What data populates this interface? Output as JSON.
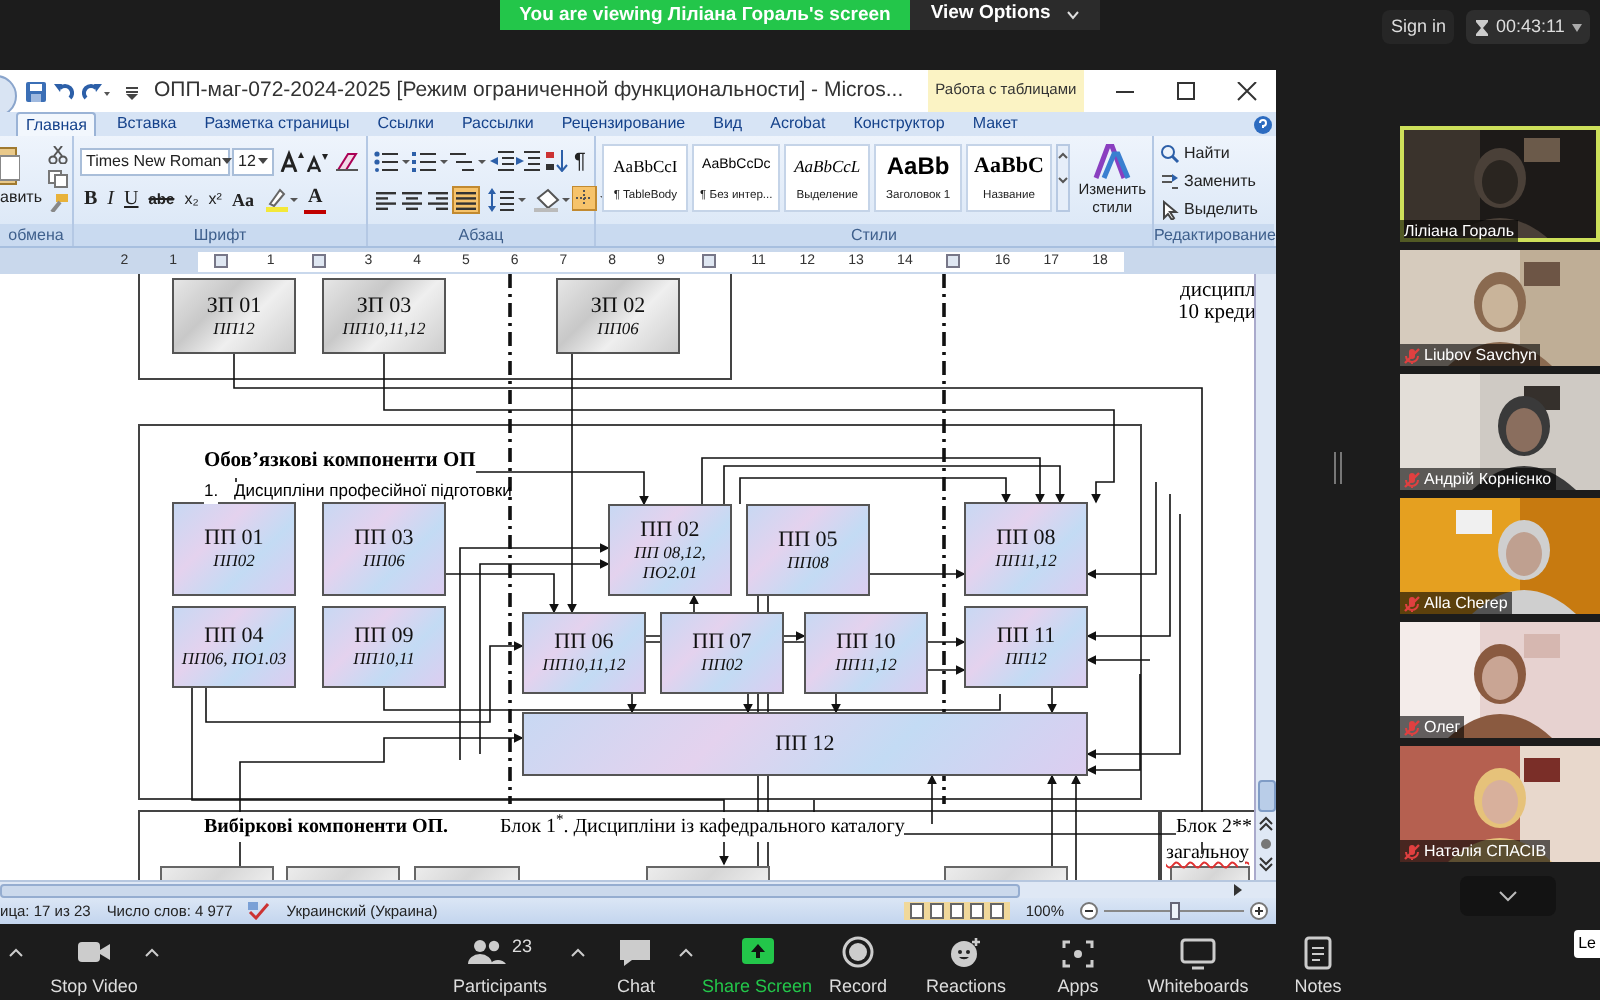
{
  "banner": {
    "text": "You are viewing Ліліана Гораль's screen",
    "view_options": "View Options"
  },
  "top_right": {
    "sign_in": "Sign in",
    "timer": "00:43:11"
  },
  "word": {
    "title": "ОПП-маг-072-2024-2025 [Режим ограниченной функциональности] - Micros...",
    "context_tab": "Работа с таблицами",
    "tabs": [
      {
        "label": "Главная",
        "selected": true
      },
      {
        "label": "Вставка",
        "selected": false
      },
      {
        "label": "Разметка страницы",
        "selected": false
      },
      {
        "label": "Ссылки",
        "selected": false
      },
      {
        "label": "Рассылки",
        "selected": false
      },
      {
        "label": "Рецензирование",
        "selected": false
      },
      {
        "label": "Вид",
        "selected": false
      },
      {
        "label": "Acrobat",
        "selected": false
      },
      {
        "label": "Конструктор",
        "selected": false
      },
      {
        "label": "Макет",
        "selected": false
      }
    ],
    "clipboard": {
      "paste_label": "авить",
      "group_label": "обмена"
    },
    "font": {
      "name": "Times New Roman",
      "size": "12",
      "format_buttons": [
        "B",
        "I",
        "U",
        "abe",
        "x₂",
        "x²",
        "Aa"
      ],
      "color_button": "A",
      "group_label": "Шрифт"
    },
    "paragraph": {
      "show_marks": "¶",
      "align_buttons": [
        {
          "selected": false
        },
        {
          "selected": false
        },
        {
          "selected": false
        },
        {
          "selected": true
        }
      ],
      "group_label": "Абзац"
    },
    "styles": {
      "items": [
        {
          "kind": "serif",
          "sample": "AaBbCcI",
          "name": "¶ TableBody"
        },
        {
          "kind": "sans",
          "sample": "AaBbCcDc",
          "name": "¶ Без интер..."
        },
        {
          "kind": "italic",
          "sample": "AaBbCcL",
          "name": "Выделение"
        },
        {
          "kind": "heading",
          "sample": "AaBb",
          "name": "Заголовок 1"
        },
        {
          "kind": "title",
          "sample": "AaBbC",
          "name": "Название"
        }
      ],
      "change_label": "Изменить стили",
      "group_label": "Стили"
    },
    "editing": {
      "items": [
        "Найти",
        "Заменить",
        "Выделить"
      ],
      "group_label": "Редактирование"
    },
    "ruler": [
      {
        "kind": "number",
        "text": "2"
      },
      {
        "kind": "number",
        "text": "1"
      },
      {
        "kind": "mark"
      },
      {
        "kind": "number",
        "text": "1"
      },
      {
        "kind": "mark"
      },
      {
        "kind": "number",
        "text": "3"
      },
      {
        "kind": "number",
        "text": "4"
      },
      {
        "kind": "number",
        "text": "5"
      },
      {
        "kind": "number",
        "text": "6"
      },
      {
        "kind": "number",
        "text": "7"
      },
      {
        "kind": "number",
        "text": "8"
      },
      {
        "kind": "number",
        "text": "9"
      },
      {
        "kind": "mark"
      },
      {
        "kind": "number",
        "text": "11"
      },
      {
        "kind": "number",
        "text": "12"
      },
      {
        "kind": "number",
        "text": "13"
      },
      {
        "kind": "number",
        "text": "14"
      },
      {
        "kind": "mark"
      },
      {
        "kind": "number",
        "text": "16"
      },
      {
        "kind": "number",
        "text": "17"
      },
      {
        "kind": "number",
        "text": "18"
      }
    ],
    "document": {
      "side_note": [
        "дисципл",
        "10 креди"
      ],
      "required_heading": "Обов’язкові компоненти ОП",
      "required_item": {
        "number": "1.",
        "text": "Дисципліни професійної підготовки"
      },
      "nodes": [
        {
          "kind": "zp",
          "title": "ЗП 01",
          "note": "ПП12"
        },
        {
          "kind": "zp",
          "title": "ЗП 03",
          "note": "ПП10,11,12"
        },
        {
          "kind": "zp",
          "title": "ЗП 02",
          "note": "ПП06"
        },
        {
          "kind": "pp",
          "title": "ПП 01",
          "note": "ПП02"
        },
        {
          "kind": "pp",
          "title": "ПП 03",
          "note": "ПП06"
        },
        {
          "kind": "pp",
          "title": "ПП 02",
          "note": "ПП 08,12, ПО2.01"
        },
        {
          "kind": "pp",
          "title": "ПП 05",
          "note": "ПП08"
        },
        {
          "kind": "pp",
          "title": "ПП 08",
          "note": "ПП11,12"
        },
        {
          "kind": "pp",
          "title": "ПП 04",
          "note": "ПП06, ПО1.03"
        },
        {
          "kind": "pp",
          "title": "ПП 09",
          "note": "ПП10,11"
        },
        {
          "kind": "pp",
          "title": "ПП 06",
          "note": "ПП10,11,12"
        },
        {
          "kind": "pp",
          "title": "ПП 07",
          "note": "ПП02"
        },
        {
          "kind": "pp",
          "title": "ПП 10",
          "note": "ПП11,12"
        },
        {
          "kind": "pp",
          "title": "ПП 11",
          "note": "ПП12"
        },
        {
          "kind": "pp",
          "title": "ПП 12"
        }
      ],
      "elective_heading": "Вибіркові компоненти ОП.",
      "block_1": "Блок 1$^{*}$. Дисципліни із кафедрального каталогу",
      "block_2": "Блок 2**",
      "block_2_note": "загальноу"
    },
    "status_bar": {
      "page": "ица: 17 из 23",
      "words": "Число слов: 4 977",
      "language": "Украинский (Украина)",
      "zoom": "100%",
      "zoom_slider": {
        "level": 0.5
      }
    }
  },
  "participants": [
    {
      "name": "Ліліана Гораль",
      "muted": false,
      "speaking": true
    },
    {
      "name": "Liubov Savchyn",
      "muted": true,
      "speaking": false
    },
    {
      "name": "Андрій Корнієнко",
      "muted": true,
      "speaking": false
    },
    {
      "name": "Alla Cherep",
      "muted": true,
      "speaking": false
    },
    {
      "name": "Олег",
      "muted": true,
      "speaking": false
    },
    {
      "name": "Наталія СПАСІВ",
      "muted": true,
      "speaking": false
    }
  ],
  "toolbar": [
    {
      "kind": "video",
      "label": "Stop Video"
    },
    {
      "kind": "participants",
      "label": "Participants",
      "count": "23"
    },
    {
      "kind": "chat",
      "label": "Chat"
    },
    {
      "kind": "share",
      "label": "Share Screen"
    },
    {
      "kind": "record",
      "label": "Record"
    },
    {
      "kind": "reactions",
      "label": "Reactions"
    },
    {
      "kind": "apps",
      "label": "Apps"
    },
    {
      "kind": "whiteboards",
      "label": "Whiteboards"
    },
    {
      "kind": "notes",
      "label": "Notes"
    }
  ],
  "tooltip": "Le"
}
